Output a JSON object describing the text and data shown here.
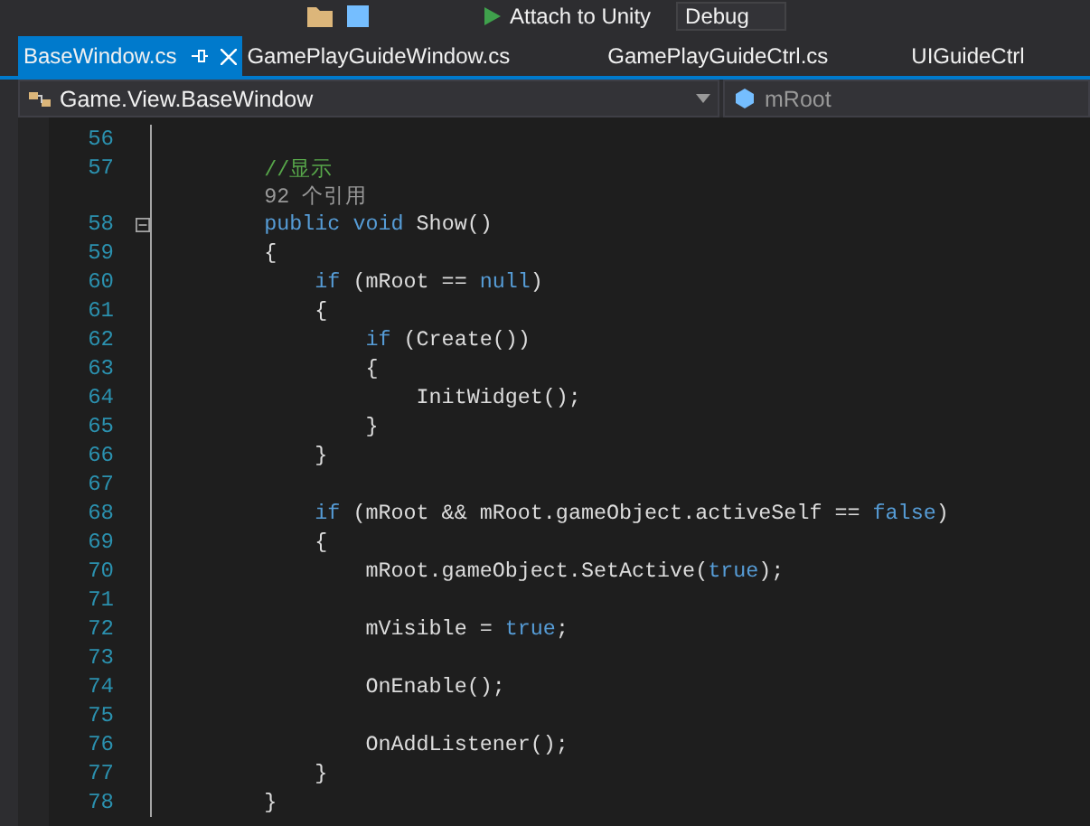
{
  "toolbar": {
    "attach_button": "Attach to Unity",
    "configuration": "Debug"
  },
  "tabs": [
    {
      "label": "BaseWindow.cs",
      "selected": true
    },
    {
      "label": "GamePlayGuideWindow.cs",
      "selected": false
    },
    {
      "label": "GamePlayGuideCtrl.cs",
      "selected": false
    },
    {
      "label": "UIGuideCtrl",
      "selected": false
    }
  ],
  "navigation": {
    "type_dropdown": "Game.View.BaseWindow",
    "member_dropdown": "mRoot"
  },
  "lines": [
    {
      "kind": "code",
      "number": "56",
      "fold": false
    },
    {
      "kind": "code",
      "number": "57",
      "fold": false,
      "tokens": [
        {
          "text": "        //显示",
          "kind": "comment"
        }
      ]
    },
    {
      "kind": "codelens",
      "text": "        92 个引用"
    },
    {
      "kind": "code",
      "number": "58",
      "fold": true,
      "tokens": [
        {
          "text": "        public",
          "kind": "keyword"
        },
        {
          "text": " void",
          "kind": "keyword"
        },
        {
          "text": " Show()",
          "kind": "plain"
        }
      ]
    },
    {
      "kind": "code",
      "number": "59",
      "fold": false,
      "tokens": [
        {
          "text": "        {",
          "kind": "plain"
        }
      ]
    },
    {
      "kind": "code",
      "number": "60",
      "fold": false,
      "tokens": [
        {
          "text": "            if",
          "kind": "keyword"
        },
        {
          "text": " (mRoot == ",
          "kind": "plain"
        },
        {
          "text": "null",
          "kind": "keyword"
        },
        {
          "text": ")",
          "kind": "plain"
        }
      ]
    },
    {
      "kind": "code",
      "number": "61",
      "fold": false,
      "tokens": [
        {
          "text": "            {",
          "kind": "plain"
        }
      ]
    },
    {
      "kind": "code",
      "number": "62",
      "fold": false,
      "tokens": [
        {
          "text": "                if",
          "kind": "keyword"
        },
        {
          "text": " (Create())",
          "kind": "plain"
        }
      ]
    },
    {
      "kind": "code",
      "number": "63",
      "fold": false,
      "tokens": [
        {
          "text": "                {",
          "kind": "plain"
        }
      ]
    },
    {
      "kind": "code",
      "number": "64",
      "fold": false,
      "tokens": [
        {
          "text": "                    InitWidget();",
          "kind": "plain"
        }
      ]
    },
    {
      "kind": "code",
      "number": "65",
      "fold": false,
      "tokens": [
        {
          "text": "                }",
          "kind": "plain"
        }
      ]
    },
    {
      "kind": "code",
      "number": "66",
      "fold": false,
      "tokens": [
        {
          "text": "            }",
          "kind": "plain"
        }
      ]
    },
    {
      "kind": "code",
      "number": "67",
      "fold": false
    },
    {
      "kind": "code",
      "number": "68",
      "fold": false,
      "tokens": [
        {
          "text": "            if",
          "kind": "keyword"
        },
        {
          "text": " (mRoot && mRoot.gameObject.activeSelf == ",
          "kind": "plain"
        },
        {
          "text": "false",
          "kind": "keyword"
        },
        {
          "text": ")",
          "kind": "plain"
        }
      ]
    },
    {
      "kind": "code",
      "number": "69",
      "fold": false,
      "tokens": [
        {
          "text": "            {",
          "kind": "plain"
        }
      ]
    },
    {
      "kind": "code",
      "number": "70",
      "fold": false,
      "tokens": [
        {
          "text": "                mRoot.gameObject.SetActive(",
          "kind": "plain"
        },
        {
          "text": "true",
          "kind": "keyword"
        },
        {
          "text": ");",
          "kind": "plain"
        }
      ]
    },
    {
      "kind": "code",
      "number": "71",
      "fold": false
    },
    {
      "kind": "code",
      "number": "72",
      "fold": false,
      "tokens": [
        {
          "text": "                mVisible = ",
          "kind": "plain"
        },
        {
          "text": "true",
          "kind": "keyword"
        },
        {
          "text": ";",
          "kind": "plain"
        }
      ]
    },
    {
      "kind": "code",
      "number": "73",
      "fold": false
    },
    {
      "kind": "code",
      "number": "74",
      "fold": false,
      "tokens": [
        {
          "text": "                OnEnable();",
          "kind": "plain"
        }
      ]
    },
    {
      "kind": "code",
      "number": "75",
      "fold": false
    },
    {
      "kind": "code",
      "number": "76",
      "fold": false,
      "tokens": [
        {
          "text": "                OnAddListener();",
          "kind": "plain"
        }
      ]
    },
    {
      "kind": "code",
      "number": "77",
      "fold": false,
      "tokens": [
        {
          "text": "            }",
          "kind": "plain"
        }
      ]
    },
    {
      "kind": "code",
      "number": "78",
      "fold": false,
      "tokens": [
        {
          "text": "        }",
          "kind": "plain"
        }
      ]
    }
  ]
}
